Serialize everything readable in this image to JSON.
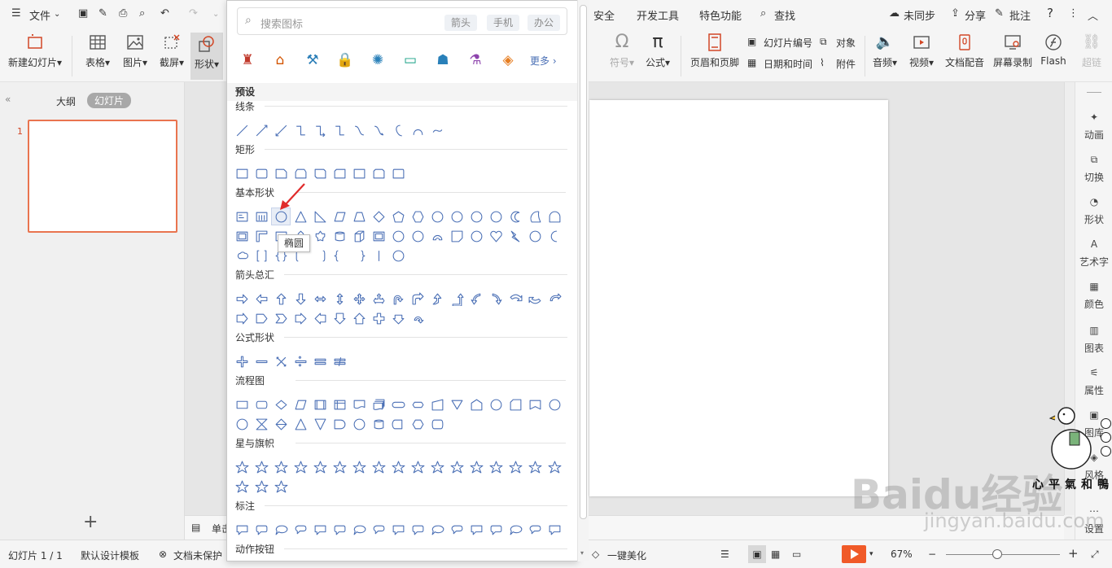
{
  "topbar": {
    "menu_file": "文件",
    "tabs": [
      "安全",
      "开发工具",
      "特色功能"
    ],
    "search": "查找",
    "sync": "未同步",
    "share": "分享",
    "comment": "批注",
    "help": "?"
  },
  "ribbon": {
    "new_slide": "新建幻灯片",
    "table": "表格",
    "picture": "图片",
    "screenshot": "截屏",
    "shape": "形状",
    "symbol": "符号",
    "formula": "公式",
    "header_footer": "页眉和页脚",
    "slide_number": "幻灯片编号",
    "date_time": "日期和时间",
    "object": "对象",
    "attachment": "附件",
    "audio": "音频",
    "video": "视频",
    "narration": "文档配音",
    "screen_record": "屏幕录制",
    "flash": "Flash",
    "hyperlink": "超链"
  },
  "left_pane": {
    "tab_outline": "大纲",
    "tab_slides": "幻灯片",
    "slide_number": "1",
    "add": "+"
  },
  "notes": {
    "label": "单击"
  },
  "right_panel": [
    "动画",
    "切换",
    "形状",
    "艺术字",
    "颜色",
    "图表",
    "属性",
    "图库",
    "风格",
    "设置"
  ],
  "status": {
    "slide_count": "幻灯片 1 / 1",
    "template": "默认设计模板",
    "protect": "文档未保护",
    "beautify": "一键美化",
    "zoom": "67%",
    "zoom_level": 0.45
  },
  "dropdown": {
    "search_placeholder": "搜索图标",
    "tags": [
      "箭头",
      "手机",
      "办公"
    ],
    "more": "更多",
    "preset": "预设",
    "categories": [
      "线条",
      "矩形",
      "基本形状",
      "箭头总汇",
      "公式形状",
      "流程图",
      "星与旗帜",
      "标注",
      "动作按钮"
    ],
    "tooltip": "椭圆"
  },
  "watermark": {
    "brand": "Baidu经验",
    "url": "jingyan.baidu.com",
    "duck_text": "心平氣和鴨"
  },
  "colors": {
    "accent": "#d24726",
    "shape_stroke": "#4a6fb5",
    "play": "#f05a28",
    "selection": "#e9744f"
  }
}
